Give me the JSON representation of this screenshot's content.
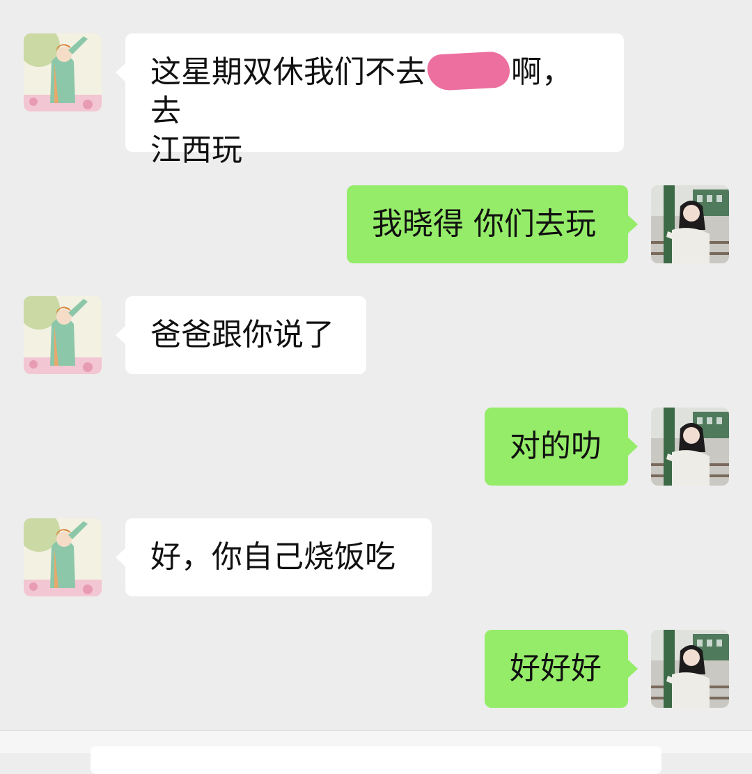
{
  "messages": [
    {
      "side": "in",
      "text_before": "这星期双休我们不去",
      "redacted": true,
      "text_after": "啊，去",
      "text_line2": "江西玩"
    },
    {
      "side": "out",
      "text": "我晓得 你们去玩"
    },
    {
      "side": "in",
      "text": "爸爸跟你说了"
    },
    {
      "side": "out",
      "text": "对的叻"
    },
    {
      "side": "in",
      "text": "好，你自己烧饭吃"
    },
    {
      "side": "out",
      "text": "好好好"
    }
  ],
  "avatars": {
    "contact": "illustrated-girl-avatar",
    "self": "photo-girl-train-avatar"
  },
  "colors": {
    "background": "#ededed",
    "incoming_bubble": "#ffffff",
    "outgoing_bubble": "#95ec69",
    "redaction": "#ec6fa0"
  }
}
